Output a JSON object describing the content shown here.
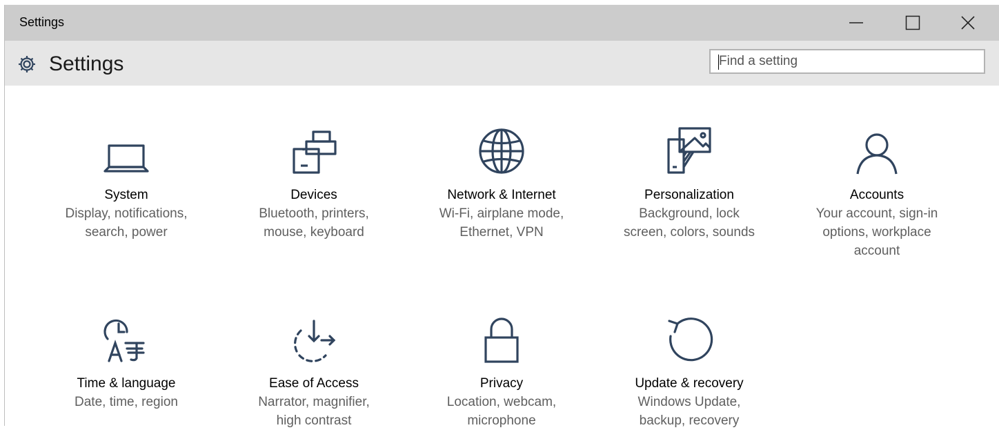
{
  "window": {
    "title": "Settings"
  },
  "header": {
    "title": "Settings",
    "search_placeholder": "Find a setting"
  },
  "colors": {
    "icon": "#30445e",
    "titlebar": "#cccccc",
    "header": "#e6e6e6"
  },
  "categories": [
    {
      "name": "System",
      "desc_line1": "Display, notifications,",
      "desc_line2": "search, power",
      "desc_line3": "",
      "icon": "laptop-icon"
    },
    {
      "name": "Devices",
      "desc_line1": "Bluetooth, printers,",
      "desc_line2": "mouse, keyboard",
      "desc_line3": "",
      "icon": "devices-icon"
    },
    {
      "name": "Network & Internet",
      "desc_line1": "Wi-Fi, airplane mode,",
      "desc_line2": "Ethernet, VPN",
      "desc_line3": "",
      "icon": "globe-icon"
    },
    {
      "name": "Personalization",
      "desc_line1": "Background, lock",
      "desc_line2": "screen, colors, sounds",
      "desc_line3": "",
      "icon": "personalization-icon"
    },
    {
      "name": "Accounts",
      "desc_line1": "Your account, sign-in",
      "desc_line2": "options, workplace",
      "desc_line3": "account",
      "icon": "person-icon"
    },
    {
      "name": "Time & language",
      "desc_line1": "Date, time, region",
      "desc_line2": "",
      "desc_line3": "",
      "icon": "time-language-icon"
    },
    {
      "name": "Ease of Access",
      "desc_line1": "Narrator, magnifier,",
      "desc_line2": "high contrast",
      "desc_line3": "",
      "icon": "ease-of-access-icon"
    },
    {
      "name": "Privacy",
      "desc_line1": "Location, webcam,",
      "desc_line2": "microphone",
      "desc_line3": "",
      "icon": "lock-icon"
    },
    {
      "name": "Update & recovery",
      "desc_line1": "Windows Update,",
      "desc_line2": "backup, recovery",
      "desc_line3": "",
      "icon": "refresh-icon"
    }
  ]
}
